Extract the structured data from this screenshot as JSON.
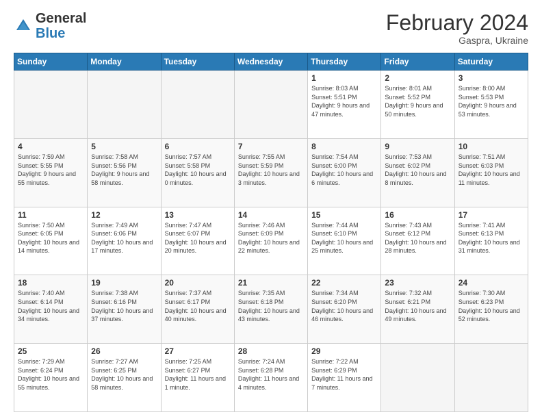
{
  "header": {
    "logo": {
      "general": "General",
      "blue": "Blue"
    },
    "title": "February 2024",
    "subtitle": "Gaspra, Ukraine"
  },
  "calendar": {
    "days_of_week": [
      "Sunday",
      "Monday",
      "Tuesday",
      "Wednesday",
      "Thursday",
      "Friday",
      "Saturday"
    ],
    "weeks": [
      {
        "days": [
          {
            "date": "",
            "info": ""
          },
          {
            "date": "",
            "info": ""
          },
          {
            "date": "",
            "info": ""
          },
          {
            "date": "",
            "info": ""
          },
          {
            "date": "1",
            "info": "Sunrise: 8:03 AM\nSunset: 5:51 PM\nDaylight: 9 hours and 47 minutes."
          },
          {
            "date": "2",
            "info": "Sunrise: 8:01 AM\nSunset: 5:52 PM\nDaylight: 9 hours and 50 minutes."
          },
          {
            "date": "3",
            "info": "Sunrise: 8:00 AM\nSunset: 5:53 PM\nDaylight: 9 hours and 53 minutes."
          }
        ]
      },
      {
        "days": [
          {
            "date": "4",
            "info": "Sunrise: 7:59 AM\nSunset: 5:55 PM\nDaylight: 9 hours and 55 minutes."
          },
          {
            "date": "5",
            "info": "Sunrise: 7:58 AM\nSunset: 5:56 PM\nDaylight: 9 hours and 58 minutes."
          },
          {
            "date": "6",
            "info": "Sunrise: 7:57 AM\nSunset: 5:58 PM\nDaylight: 10 hours and 0 minutes."
          },
          {
            "date": "7",
            "info": "Sunrise: 7:55 AM\nSunset: 5:59 PM\nDaylight: 10 hours and 3 minutes."
          },
          {
            "date": "8",
            "info": "Sunrise: 7:54 AM\nSunset: 6:00 PM\nDaylight: 10 hours and 6 minutes."
          },
          {
            "date": "9",
            "info": "Sunrise: 7:53 AM\nSunset: 6:02 PM\nDaylight: 10 hours and 8 minutes."
          },
          {
            "date": "10",
            "info": "Sunrise: 7:51 AM\nSunset: 6:03 PM\nDaylight: 10 hours and 11 minutes."
          }
        ]
      },
      {
        "days": [
          {
            "date": "11",
            "info": "Sunrise: 7:50 AM\nSunset: 6:05 PM\nDaylight: 10 hours and 14 minutes."
          },
          {
            "date": "12",
            "info": "Sunrise: 7:49 AM\nSunset: 6:06 PM\nDaylight: 10 hours and 17 minutes."
          },
          {
            "date": "13",
            "info": "Sunrise: 7:47 AM\nSunset: 6:07 PM\nDaylight: 10 hours and 20 minutes."
          },
          {
            "date": "14",
            "info": "Sunrise: 7:46 AM\nSunset: 6:09 PM\nDaylight: 10 hours and 22 minutes."
          },
          {
            "date": "15",
            "info": "Sunrise: 7:44 AM\nSunset: 6:10 PM\nDaylight: 10 hours and 25 minutes."
          },
          {
            "date": "16",
            "info": "Sunrise: 7:43 AM\nSunset: 6:12 PM\nDaylight: 10 hours and 28 minutes."
          },
          {
            "date": "17",
            "info": "Sunrise: 7:41 AM\nSunset: 6:13 PM\nDaylight: 10 hours and 31 minutes."
          }
        ]
      },
      {
        "days": [
          {
            "date": "18",
            "info": "Sunrise: 7:40 AM\nSunset: 6:14 PM\nDaylight: 10 hours and 34 minutes."
          },
          {
            "date": "19",
            "info": "Sunrise: 7:38 AM\nSunset: 6:16 PM\nDaylight: 10 hours and 37 minutes."
          },
          {
            "date": "20",
            "info": "Sunrise: 7:37 AM\nSunset: 6:17 PM\nDaylight: 10 hours and 40 minutes."
          },
          {
            "date": "21",
            "info": "Sunrise: 7:35 AM\nSunset: 6:18 PM\nDaylight: 10 hours and 43 minutes."
          },
          {
            "date": "22",
            "info": "Sunrise: 7:34 AM\nSunset: 6:20 PM\nDaylight: 10 hours and 46 minutes."
          },
          {
            "date": "23",
            "info": "Sunrise: 7:32 AM\nSunset: 6:21 PM\nDaylight: 10 hours and 49 minutes."
          },
          {
            "date": "24",
            "info": "Sunrise: 7:30 AM\nSunset: 6:23 PM\nDaylight: 10 hours and 52 minutes."
          }
        ]
      },
      {
        "days": [
          {
            "date": "25",
            "info": "Sunrise: 7:29 AM\nSunset: 6:24 PM\nDaylight: 10 hours and 55 minutes."
          },
          {
            "date": "26",
            "info": "Sunrise: 7:27 AM\nSunset: 6:25 PM\nDaylight: 10 hours and 58 minutes."
          },
          {
            "date": "27",
            "info": "Sunrise: 7:25 AM\nSunset: 6:27 PM\nDaylight: 11 hours and 1 minute."
          },
          {
            "date": "28",
            "info": "Sunrise: 7:24 AM\nSunset: 6:28 PM\nDaylight: 11 hours and 4 minutes."
          },
          {
            "date": "29",
            "info": "Sunrise: 7:22 AM\nSunset: 6:29 PM\nDaylight: 11 hours and 7 minutes."
          },
          {
            "date": "",
            "info": ""
          },
          {
            "date": "",
            "info": ""
          }
        ]
      }
    ]
  }
}
